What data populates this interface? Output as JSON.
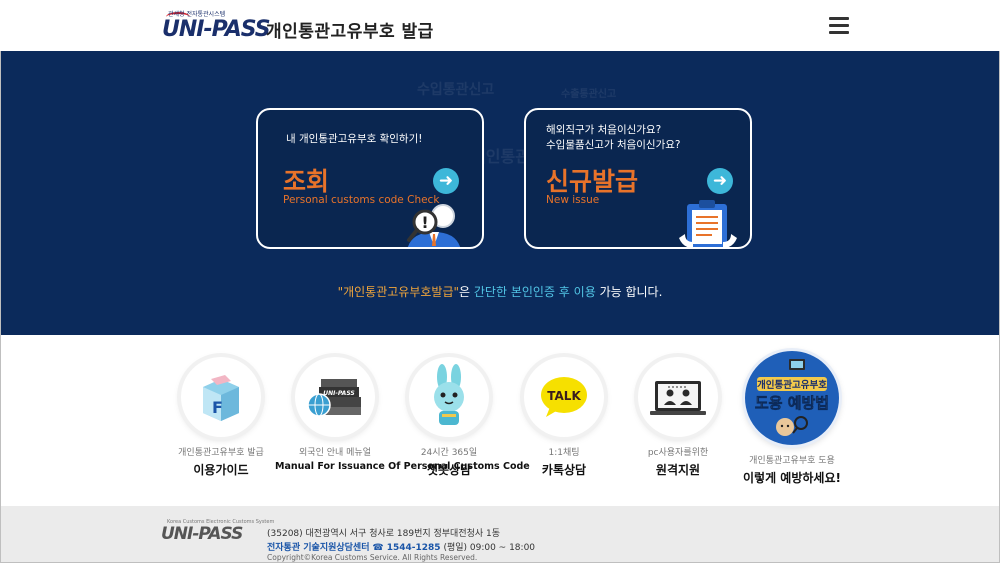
{
  "header": {
    "logo_sub": "관세청 전자통관시스템",
    "logo_text": "UNI-PASS",
    "title": "개인통관고유부호 발급",
    "menu_icon": "hamburger-icon"
  },
  "hero": {
    "bg_texts": [
      "수입통관신고",
      "수출통관신고",
      "개인통관"
    ],
    "cards": [
      {
        "desc_lines": [
          "내 개인통관고유부호 확인하기!"
        ],
        "title": "조회",
        "subtitle": "Personal customs code Check",
        "arrow_icon": "arrow-right-icon",
        "illus_icon": "magnifier-person-icon"
      },
      {
        "desc_lines": [
          "해외직구가 처음이신가요?",
          "수입물품신고가 처음이신가요?"
        ],
        "title": "신규발급",
        "subtitle": "New issue",
        "arrow_icon": "arrow-right-icon",
        "illus_icon": "document-clipboard-icon"
      }
    ],
    "notice": {
      "quoted": "\"개인통관고유부호발급\"",
      "mid": "은 ",
      "highlight": "간단한 본인인증 후 이용",
      "tail": " 가능 합니다."
    },
    "colors": {
      "background": "#0b2a5b",
      "accent_orange": "#e8732a",
      "accent_cyan": "#3db7d9"
    }
  },
  "services": [
    {
      "small": "개인통관고유부호 발급",
      "big": "이용가이드",
      "icon": "guide-box-icon"
    },
    {
      "small": "외국인 안내 메뉴얼",
      "big": "Manual For Issuance Of Personal Customs Code",
      "icon": "manual-books-icon"
    },
    {
      "small": "24시간 365일",
      "big": "챗봇상담",
      "icon": "chatbot-rabbit-icon"
    },
    {
      "small": "1:1채팅",
      "big": "카톡상담",
      "icon": "kakaotalk-icon"
    },
    {
      "small": "pc사용자를위한",
      "big": "원격지원",
      "icon": "remote-support-icon"
    },
    {
      "small": "개인통관고유부호 도용",
      "big": "이렇게 예방하세요!",
      "icon": "prevention-badge-icon",
      "badge_line1": "개인통관고유부호",
      "badge_line2": "도용 예방법"
    }
  ],
  "footer": {
    "logo_sub": "Korea Customs Electronic Customs System",
    "logo_text": "UNI-PASS",
    "address": "(35208) 대전광역시 서구 청사로 189번지 정부대전청사 1동",
    "support_label": "전자통관 기술지원상담센터",
    "support_phone": "☎ 1544-1285",
    "support_hours": "(평일) 09:00 ~ 18:00",
    "copyright": "Copyright©Korea Customs Service. All Rights Reserved."
  }
}
